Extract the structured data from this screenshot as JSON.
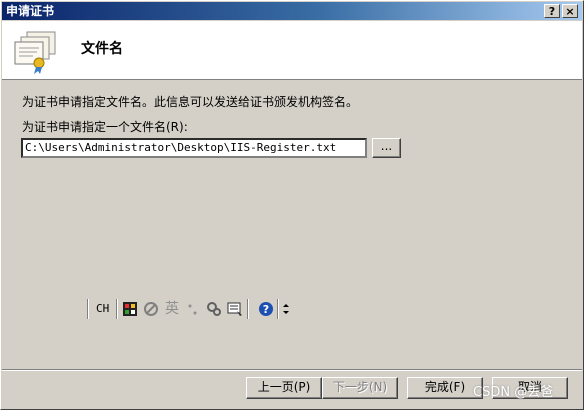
{
  "window": {
    "title": "申请证书",
    "help_label": "?",
    "close_label": "×"
  },
  "header": {
    "title": "文件名",
    "icon": "certificate-icon"
  },
  "content": {
    "description": "为证书申请指定文件名。此信息可以发送给证书颁发机构签名。",
    "field_label": "为证书申请指定一个文件名(R):",
    "file_value": "C:\\Users\\Administrator\\Desktop\\IIS-Register.txt",
    "browse_label": "..."
  },
  "ime_bar": {
    "lang_label": "CH",
    "icons": [
      "ime-keyboard-icon",
      "ime-disable-icon",
      "english-mode-icon",
      "punctuation-icon",
      "settings-icon",
      "soft-keyboard-icon",
      "help-icon",
      "options-icon"
    ],
    "english_label": "英"
  },
  "footer": {
    "prev_label": "上一页(P)",
    "next_label": "下一步(N)",
    "finish_label": "完成(F)",
    "cancel_label": "取消"
  },
  "watermark": "CSDN @丢爸",
  "colors": {
    "title_bar_start": "#0a246a",
    "title_bar_end": "#a6caf0",
    "face": "#d4d0c8"
  }
}
